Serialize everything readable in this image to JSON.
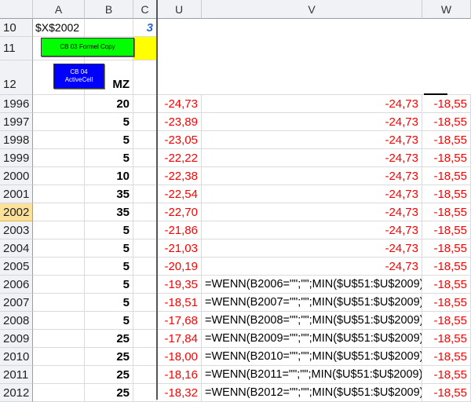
{
  "columns": {
    "a": "A",
    "b": "B",
    "c": "C",
    "u": "U",
    "v": "V",
    "w": "W"
  },
  "top": {
    "r10": {
      "num": "10",
      "a": "$X$2002",
      "c": "3"
    },
    "r11": {
      "num": "11"
    },
    "r12": {
      "num": "12",
      "b_partial": "MZ"
    }
  },
  "buttons": {
    "formel_copy": "CB 03 Formel Copy",
    "active_cell_line1": "CB 04",
    "active_cell_line2": "ActiveCell"
  },
  "rows": [
    {
      "year": "1996",
      "b": "20",
      "u": "-24,73",
      "v": "-24,73",
      "w": "-18,55"
    },
    {
      "year": "1997",
      "b": "5",
      "u": "-23,89",
      "v": "-24,73",
      "w": "-18,55"
    },
    {
      "year": "1998",
      "b": "5",
      "u": "-23,05",
      "v": "-24,73",
      "w": "-18,55"
    },
    {
      "year": "1999",
      "b": "5",
      "u": "-22,22",
      "v": "-24,73",
      "w": "-18,55"
    },
    {
      "year": "2000",
      "b": "10",
      "u": "-22,38",
      "v": "-24,73",
      "w": "-18,55"
    },
    {
      "year": "2001",
      "b": "35",
      "u": "-22,54",
      "v": "-24,73",
      "w": "-18,55"
    },
    {
      "year": "2002",
      "b": "35",
      "u": "-22,70",
      "v": "-24,73",
      "w": "-18,55"
    },
    {
      "year": "2003",
      "b": "5",
      "u": "-21,86",
      "v": "-24,73",
      "w": "-18,55"
    },
    {
      "year": "2004",
      "b": "5",
      "u": "-21,03",
      "v": "-24,73",
      "w": "-18,55"
    },
    {
      "year": "2005",
      "b": "5",
      "u": "-20,19",
      "v": "-24,73",
      "w": "-18,55"
    },
    {
      "year": "2006",
      "b": "5",
      "u": "-19,35",
      "v": "=WENN(B2006=\"\";\"\";MIN($U$51:$U$2009))",
      "w": "-18,55"
    },
    {
      "year": "2007",
      "b": "5",
      "u": "-18,51",
      "v": "=WENN(B2007=\"\";\"\";MIN($U$51:$U$2009))",
      "w": "-18,55"
    },
    {
      "year": "2008",
      "b": "5",
      "u": "-17,68",
      "v": "=WENN(B2008=\"\";\"\";MIN($U$51:$U$2009))",
      "w": "-18,55"
    },
    {
      "year": "2009",
      "b": "25",
      "u": "-17,84",
      "v": "=WENN(B2009=\"\";\"\";MIN($U$51:$U$2009))",
      "w": "-18,55"
    },
    {
      "year": "2010",
      "b": "25",
      "u": "-18,00",
      "v": "=WENN(B2010=\"\";\"\";MIN($U$51:$U$2009))",
      "w": "-18,55"
    },
    {
      "year": "2011",
      "b": "25",
      "u": "-18,16",
      "v": "=WENN(B2011=\"\";\"\";MIN($U$51:$U$2009))",
      "w": "-18,55"
    },
    {
      "year": "2012",
      "b": "25",
      "u": "-18,32",
      "v": "=WENN(B2012=\"\";\"\";MIN($U$51:$U$2009))",
      "w": "-18,55"
    }
  ],
  "colors": {
    "green_button": "#00ff00",
    "blue_button": "#0000ff",
    "yellow_fill": "#ffff00",
    "red_text": "#ff0000",
    "blue_text": "#3366cc"
  }
}
